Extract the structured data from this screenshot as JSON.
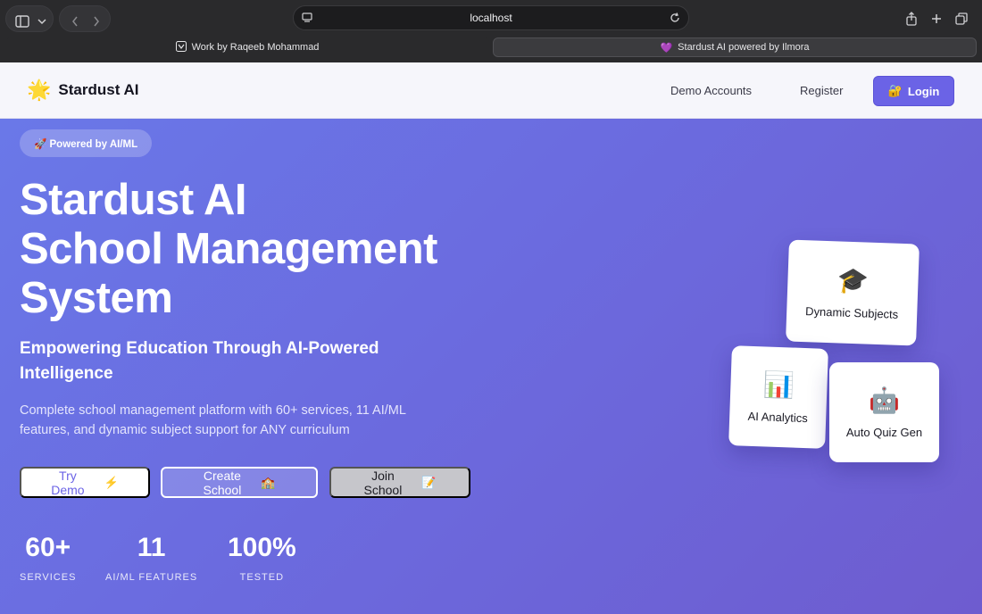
{
  "browser": {
    "address": "localhost",
    "tabs": [
      {
        "label": "Work by Raqeeb Mohammad"
      },
      {
        "label": "Stardust AI powered by Ilmora"
      }
    ]
  },
  "header": {
    "brand": "Stardust AI",
    "nav": {
      "demo_accounts": "Demo Accounts",
      "register": "Register",
      "login": "Login"
    }
  },
  "hero": {
    "badge": "🚀 Powered by AI/ML",
    "title_lines": [
      "Stardust AI",
      "School Management",
      "System"
    ],
    "subtitle": "Empowering Education Through AI-Powered Intelligence",
    "description": "Complete school management platform with 60+ services, 11 AI/ML features, and dynamic subject support for ANY curriculum",
    "buttons": {
      "try_demo": {
        "line1": "Try",
        "line2": "Demo",
        "icon": "⚡"
      },
      "create_school": {
        "line1": "Create",
        "line2": "School",
        "icon": "🏫"
      },
      "join_school": {
        "line1": "Join",
        "line2": "School",
        "icon": "📝"
      }
    },
    "stats": [
      {
        "value": "60+",
        "label": "SERVICES"
      },
      {
        "value": "11",
        "label": "AI/ML FEATURES"
      },
      {
        "value": "100%",
        "label": "TESTED"
      }
    ]
  },
  "cards": {
    "subjects": {
      "icon": "🎓",
      "label": "Dynamic Subjects"
    },
    "analytics": {
      "icon": "📊",
      "label": "AI Analytics"
    },
    "quiz": {
      "icon": "🤖",
      "label": "Auto Quiz Gen"
    }
  },
  "colors": {
    "accent": "#6b63e6",
    "hero_start": "#6a78e8",
    "hero_end": "#6e5ccf"
  }
}
